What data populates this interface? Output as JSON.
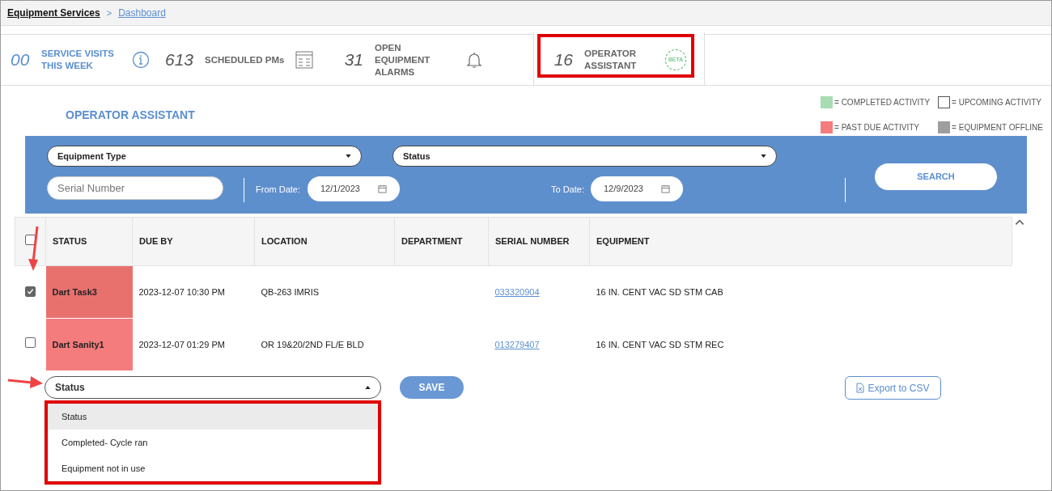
{
  "breadcrumb": [
    {
      "label": "Equipment Services",
      "kind": "root"
    },
    {
      "label": "Dashboard",
      "kind": "link"
    }
  ],
  "breadcrumb_separator": ">",
  "summary_tabs": [
    {
      "count": "00",
      "label": "SERVICE VISITS THIS WEEK",
      "kind": "info",
      "selected": false
    },
    {
      "count": "613",
      "label": "SCHEDULED PMs",
      "kind": "calendar",
      "selected": false
    },
    {
      "count": "31",
      "label": "OPEN EQUIPMENT ALARMS",
      "kind": "bell",
      "selected": false
    },
    {
      "count": "16",
      "label": "OPERATOR ASSISTANT",
      "kind": "beta",
      "badge": "BETA",
      "selected": true
    }
  ],
  "section_title": "OPERATOR ASSISTANT",
  "legend": [
    {
      "label": "= COMPLETED ACTIVITY",
      "color": "#a8dcb2"
    },
    {
      "label": "= UPCOMING ACTIVITY",
      "color": "#ffffff"
    },
    {
      "label": "= PAST DUE ACTIVITY",
      "color": "#f47c7c"
    },
    {
      "label": "= EQUIPMENT OFFLINE",
      "color": "#9e9e9e"
    }
  ],
  "filters": {
    "equipment_type": "Equipment Type",
    "status": "Status",
    "serial_placeholder": "Serial Number",
    "from_label": "From Date:",
    "from_value": "12/1/2023",
    "to_label": "To Date:",
    "to_value": "12/9/2023",
    "search": "SEARCH"
  },
  "table": {
    "select_all_checked": false,
    "columns": [
      "STATUS",
      "DUE BY",
      "LOCATION",
      "DEPARTMENT",
      "SERIAL NUMBER",
      "EQUIPMENT"
    ],
    "rows": [
      {
        "checked": true,
        "status": "Dart Task3",
        "color": "#e8716e",
        "due_by": "2023-12-07 10:30 PM",
        "location": "QB-263 IMRIS",
        "serial": "033320904",
        "equipment": "16 IN. CENT VAC SD STM CAB"
      },
      {
        "checked": false,
        "status": "Dart Sanity1",
        "color": "#f47c7c",
        "due_by": "2023-12-07 01:29 PM",
        "location": "OR 19&20/2ND FL/E BLD",
        "serial": "013279407",
        "equipment": "16 IN. CENT VAC SD STM REC"
      }
    ]
  },
  "bulk_status": {
    "value": "Status",
    "expanded": true,
    "options": [
      {
        "label": "Status",
        "selected": true
      },
      {
        "label": "Completed- Cycle ran",
        "selected": false
      },
      {
        "label": "Equipment not in use",
        "selected": false
      }
    ]
  },
  "save_button": "SAVE",
  "export_button": "Export to CSV"
}
